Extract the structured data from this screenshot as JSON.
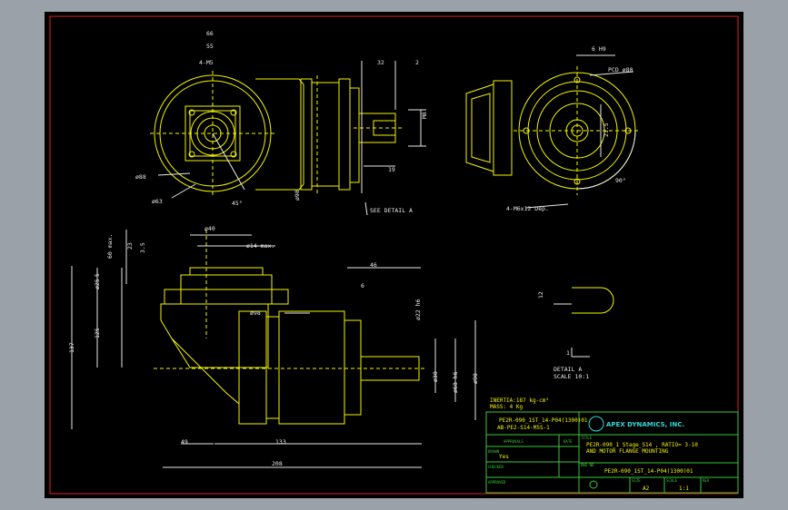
{
  "colors": {
    "background": "#9aa1a8",
    "canvas": "#000000",
    "outline": "#f4f400",
    "border": "#e02020",
    "titleblock": "#38c838",
    "logo": "#30d8d8",
    "dimensions": "#e8e8e8"
  },
  "top_view": {
    "dims": [
      "66",
      "55",
      "4-M5",
      "ø88",
      "ø63",
      "45°",
      "ø98",
      "32",
      "2",
      "M8",
      "19",
      "SEE DETAIL A"
    ]
  },
  "side_view": {
    "dims": [
      "6 H9",
      "PCD ø80",
      "4-M6x12 Dep.",
      "90°",
      "21.5"
    ]
  },
  "section_view": {
    "dims": [
      "ø40",
      "ø14 max.",
      "60 max.",
      "23",
      "3.5",
      "5",
      "ø25",
      "46",
      "ø22 h6",
      "6",
      "ø98",
      "ø30",
      "ø68 h6",
      "ø90",
      "125",
      "137",
      "49",
      "133",
      "208"
    ],
    "inertia": "INERTIA:187 kg-cm²",
    "mass": "MASS: 4 Kg"
  },
  "detail_a": {
    "dims": [
      "12",
      "1"
    ],
    "title": "DETAIL A",
    "scale": "SCALE 10:1"
  },
  "title_block": {
    "logo_text": "APEX DYNAMICS, INC.",
    "model_line1": "PE2R-090_1ST_14-P04(1300)01",
    "model_line2": "AB-PE2-S14-M5S-1",
    "approval_label": "APPROVALS",
    "date_label": "DATE",
    "drawn_label": "DRAWN",
    "drawn_value": "Yes",
    "checked_label": "CHECKED",
    "approved_label": "APPROVED",
    "title_label": "TITLE",
    "title_line1": "PE2R-090_1 Stage_S14 , RATIO= 3-10",
    "title_line2": "AND MOTOR FLANGE MOUNTING",
    "dwg_label": "DWG NO",
    "dwg_no": "PE2R-090_1ST_14-P04(1300)01",
    "size_label": "SIZE",
    "size_value": "A2",
    "scale_label": "SCALE",
    "scale_value": "1:1",
    "rev_label": "REV"
  }
}
